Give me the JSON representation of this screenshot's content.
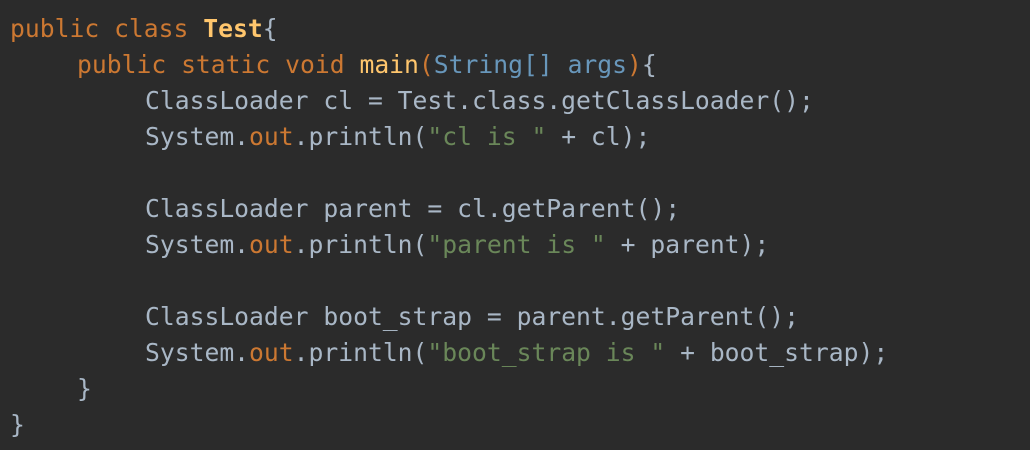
{
  "editor": {
    "theme": {
      "background": "#2b2b2b",
      "default_text": "#a9b7c6",
      "keyword": "#cc7832",
      "class_name": "#ffc66d",
      "method_name": "#ffc66d",
      "type_param": "#6897bb",
      "string": "#6a8759"
    },
    "lines": [
      {
        "indent": 0,
        "tokens": [
          {
            "t": "public",
            "k": "keyword"
          },
          {
            "t": " ",
            "k": "plain"
          },
          {
            "t": "class",
            "k": "keyword"
          },
          {
            "t": " ",
            "k": "plain"
          },
          {
            "t": "Test",
            "k": "classname"
          },
          {
            "t": "{",
            "k": "brace"
          }
        ]
      },
      {
        "indent": 1,
        "tokens": [
          {
            "t": "public",
            "k": "keyword"
          },
          {
            "t": " ",
            "k": "plain"
          },
          {
            "t": "static",
            "k": "keyword"
          },
          {
            "t": " ",
            "k": "plain"
          },
          {
            "t": "void",
            "k": "keyword"
          },
          {
            "t": " ",
            "k": "plain"
          },
          {
            "t": "main",
            "k": "method"
          },
          {
            "t": "(",
            "k": "paren"
          },
          {
            "t": "String[]",
            "k": "type"
          },
          {
            "t": " ",
            "k": "plain"
          },
          {
            "t": "args",
            "k": "param"
          },
          {
            "t": ")",
            "k": "paren"
          },
          {
            "t": "{",
            "k": "brace"
          }
        ]
      },
      {
        "indent": 2,
        "tokens": [
          {
            "t": "ClassLoader cl = Test.class.getClassLoader();",
            "k": "plain"
          }
        ]
      },
      {
        "indent": 2,
        "tokens": [
          {
            "t": "System.",
            "k": "plain"
          },
          {
            "t": "out",
            "k": "field"
          },
          {
            "t": ".println(",
            "k": "plain"
          },
          {
            "t": "\"cl is \"",
            "k": "string"
          },
          {
            "t": " + cl);",
            "k": "plain"
          }
        ]
      },
      {
        "indent": 2,
        "tokens": []
      },
      {
        "indent": 2,
        "tokens": [
          {
            "t": "ClassLoader parent = cl.getParent();",
            "k": "plain"
          }
        ]
      },
      {
        "indent": 2,
        "tokens": [
          {
            "t": "System.",
            "k": "plain"
          },
          {
            "t": "out",
            "k": "field"
          },
          {
            "t": ".println(",
            "k": "plain"
          },
          {
            "t": "\"parent is \"",
            "k": "string"
          },
          {
            "t": " + parent);",
            "k": "plain"
          }
        ]
      },
      {
        "indent": 2,
        "tokens": []
      },
      {
        "indent": 2,
        "tokens": [
          {
            "t": "ClassLoader boot_strap = parent.getParent();",
            "k": "plain"
          }
        ]
      },
      {
        "indent": 2,
        "tokens": [
          {
            "t": "System.",
            "k": "plain"
          },
          {
            "t": "out",
            "k": "field"
          },
          {
            "t": ".println(",
            "k": "plain"
          },
          {
            "t": "\"boot_strap is \"",
            "k": "string"
          },
          {
            "t": " + boot_strap);",
            "k": "plain"
          }
        ]
      },
      {
        "indent": 1,
        "tokens": [
          {
            "t": "}",
            "k": "brace"
          }
        ]
      },
      {
        "indent": 0,
        "tokens": [
          {
            "t": "}",
            "k": "brace"
          }
        ]
      }
    ]
  }
}
